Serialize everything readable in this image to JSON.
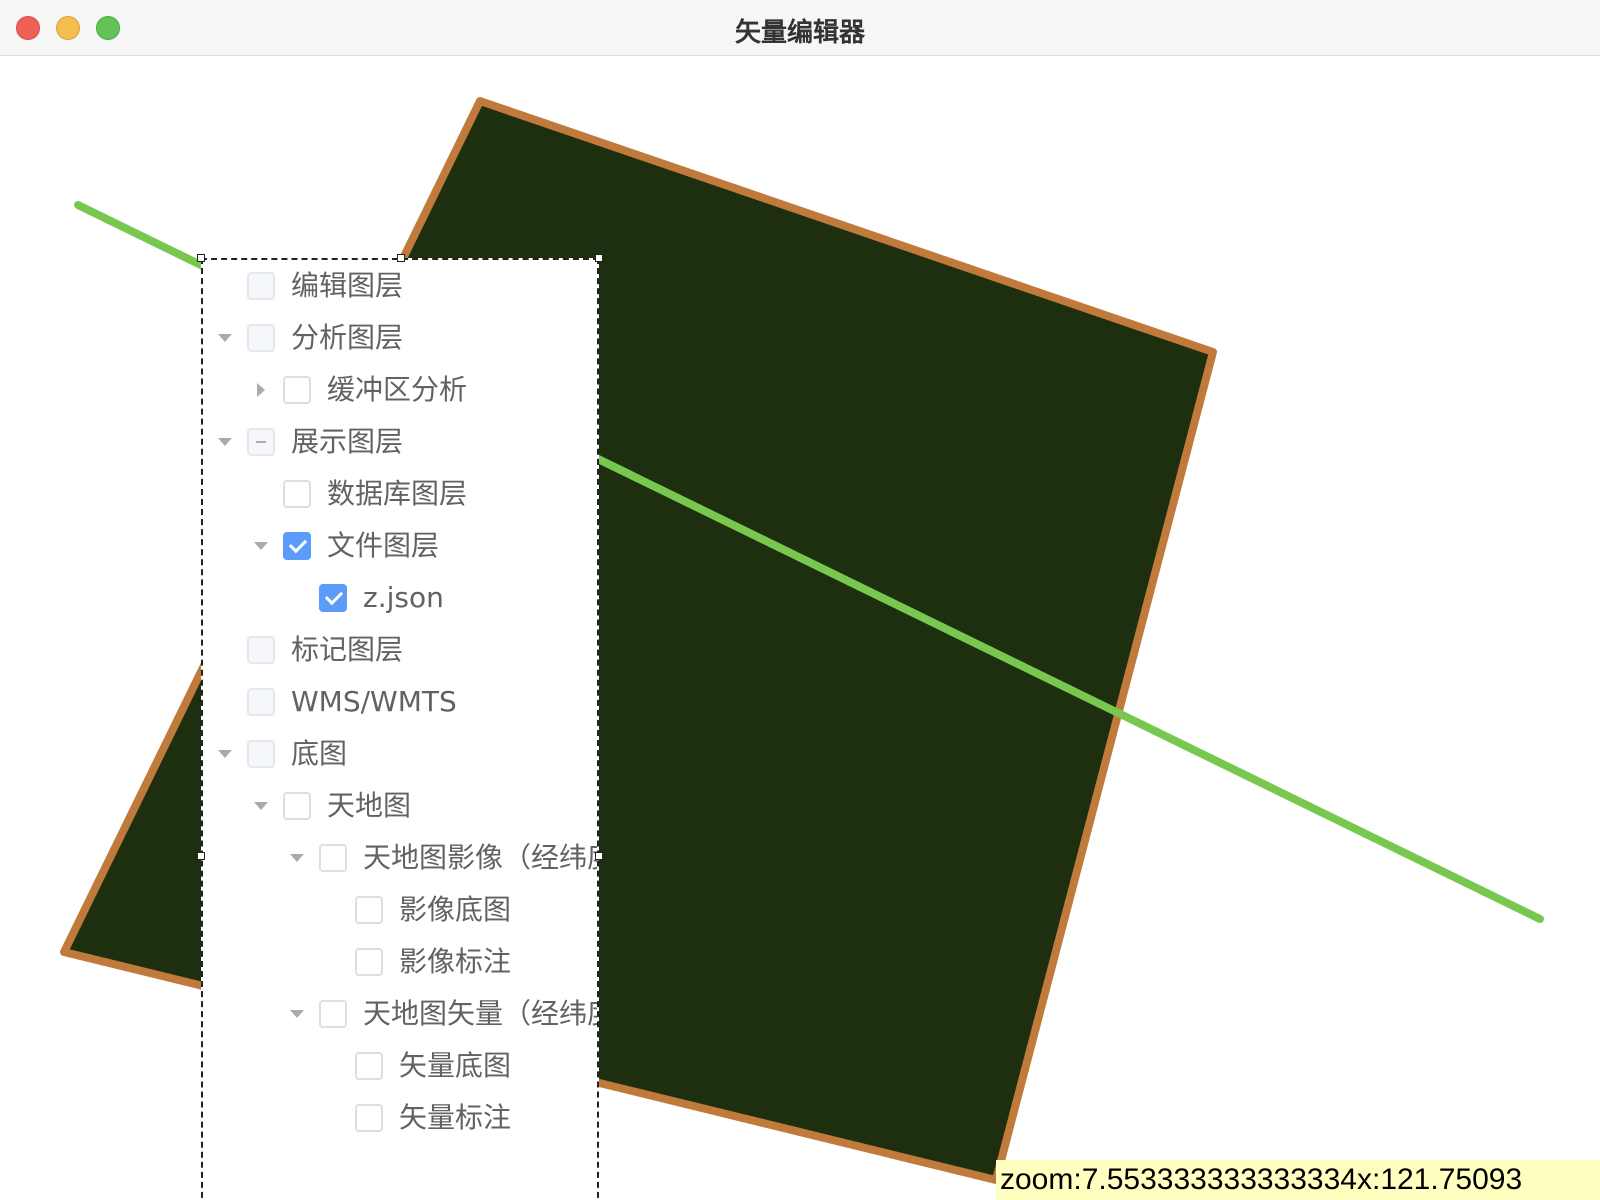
{
  "window": {
    "title": "矢量编辑器"
  },
  "map": {
    "polygon_fill": "#1d2f0e",
    "polygon_stroke": "#c07a3c",
    "line_color": "#78c850"
  },
  "layer_tree": {
    "items": [
      {
        "label": "编辑图层",
        "state": "unchecked"
      },
      {
        "label": "分析图层",
        "state": "unchecked",
        "expanded": true
      },
      {
        "label": "缓冲区分析",
        "state": "unchecked",
        "expanded": false
      },
      {
        "label": "展示图层",
        "state": "indeterminate",
        "expanded": true
      },
      {
        "label": "数据库图层",
        "state": "unchecked"
      },
      {
        "label": "文件图层",
        "state": "checked",
        "expanded": true
      },
      {
        "label": "z.json",
        "state": "checked"
      },
      {
        "label": "标记图层",
        "state": "unchecked"
      },
      {
        "label": "WMS/WMTS",
        "state": "unchecked"
      },
      {
        "label": "底图",
        "state": "unchecked",
        "expanded": true
      },
      {
        "label": "天地图",
        "state": "unchecked",
        "expanded": true
      },
      {
        "label": "天地图影像（经纬度",
        "state": "unchecked",
        "expanded": true
      },
      {
        "label": "影像底图",
        "state": "unchecked"
      },
      {
        "label": "影像标注",
        "state": "unchecked"
      },
      {
        "label": "天地图矢量（经纬度",
        "state": "unchecked",
        "expanded": true
      },
      {
        "label": "矢量底图",
        "state": "unchecked"
      },
      {
        "label": "矢量标注",
        "state": "unchecked"
      }
    ]
  },
  "status": {
    "text": "zoom:7.553333333333334x:121.75093"
  }
}
